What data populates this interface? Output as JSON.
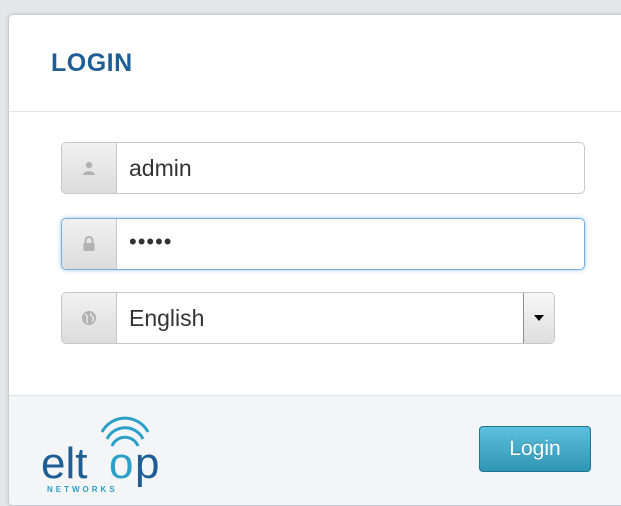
{
  "login": {
    "title": "LOGIN",
    "username": {
      "value": "admin",
      "icon": "user-icon"
    },
    "password": {
      "value": "•••••",
      "icon": "lock-icon"
    },
    "language": {
      "selected": "English",
      "icon": "globe-icon"
    },
    "submit_label": "Login"
  },
  "brand": {
    "name": "eltop",
    "tagline": "NETWORKS",
    "colors": {
      "primary": "#1f5e94",
      "accent": "#2aa0c9",
      "button": "#3aa6c8"
    }
  }
}
